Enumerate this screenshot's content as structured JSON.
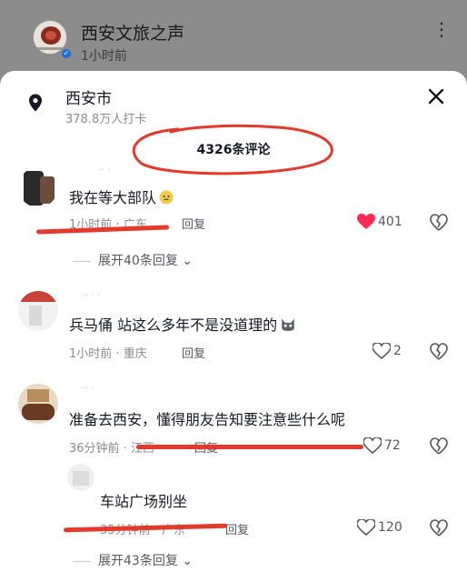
{
  "post": {
    "account": "西安文旅之声",
    "time": "1小时前"
  },
  "location": {
    "name": "西安市",
    "checkins": "378.8万人打卡"
  },
  "comments_count": "4326条评论",
  "comments": [
    {
      "text": "我在等大部队",
      "time": "1小时前",
      "region": "广东",
      "reply": "回复",
      "likes": "401"
    },
    {
      "text": "兵马俑  站这么多年不是没道理的",
      "time": "1小时前",
      "region": "重庆",
      "reply": "回复",
      "likes": "2"
    },
    {
      "text": "准备去西安，懂得朋友告知要注意些什么呢",
      "time": "36分钟前",
      "region": "江西",
      "reply": "回复",
      "likes": "72"
    },
    {
      "text": "车站广场别坐",
      "time": "35分钟前",
      "region": "广东",
      "reply": "回复",
      "likes": "120"
    }
  ],
  "expand_1": "展开40条回复",
  "expand_2": "展开43条回复",
  "separator": "·",
  "icons": {
    "location": "location-pin-icon",
    "close": "close-icon",
    "like": "heart-icon",
    "dislike": "broken-heart-icon",
    "more": "more-vertical-icon"
  },
  "colors": {
    "like_active": "#fe2c55",
    "annotation": "#e33a2b"
  }
}
